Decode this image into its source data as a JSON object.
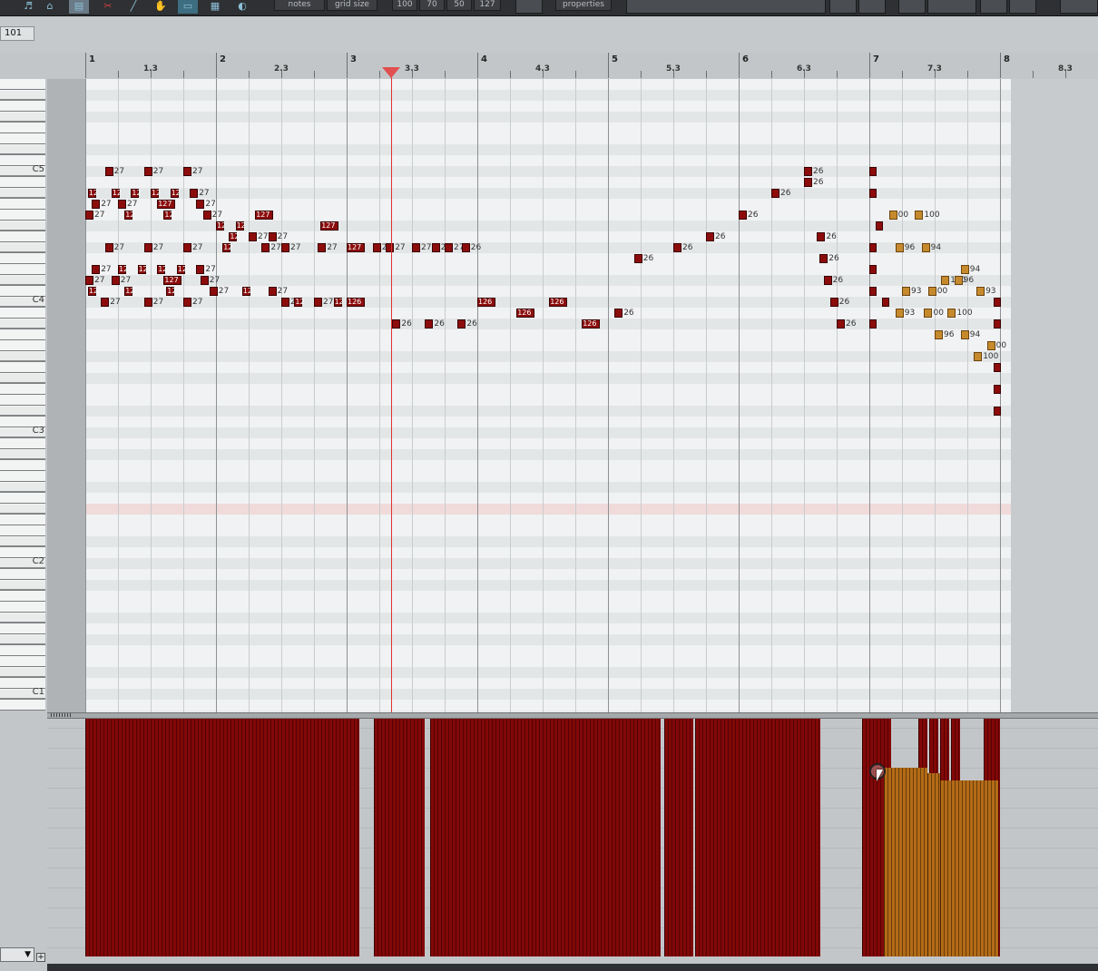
{
  "toolbar": {
    "notes_label": "notes",
    "grid_size_label": "grid size",
    "velocity_presets": [
      "100",
      "70",
      "50",
      "127"
    ],
    "properties_label": "properties"
  },
  "value_box": "101",
  "ruler": {
    "bars": [
      "1",
      "2",
      "3",
      "4",
      "5",
      "6",
      "7",
      "8"
    ],
    "beats": [
      "1.3",
      "2.3",
      "3.3",
      "4.3",
      "5.3",
      "6.3",
      "7.3",
      "8.3"
    ]
  },
  "keyboard": {
    "octave_labels": [
      "C5",
      "C4",
      "C3",
      "C2",
      "C1"
    ]
  },
  "notes": [
    {
      "beat": 0.15,
      "row": 8,
      "v": "27"
    },
    {
      "beat": 0.45,
      "row": 8,
      "v": "27"
    },
    {
      "beat": 0.75,
      "row": 8,
      "v": "27"
    },
    {
      "beat": 0.02,
      "row": 10,
      "v": "12"
    },
    {
      "beat": 0.2,
      "row": 10,
      "v": "12"
    },
    {
      "beat": 0.35,
      "row": 10,
      "v": "12"
    },
    {
      "beat": 0.5,
      "row": 10,
      "v": "12"
    },
    {
      "beat": 0.65,
      "row": 10,
      "v": "12"
    },
    {
      "beat": 0.8,
      "row": 10,
      "v": "27"
    },
    {
      "beat": 0.05,
      "row": 11,
      "v": "27"
    },
    {
      "beat": 0.25,
      "row": 11,
      "v": "27"
    },
    {
      "beat": 0.55,
      "row": 11,
      "v": "127"
    },
    {
      "beat": 0.85,
      "row": 11,
      "v": "27"
    },
    {
      "beat": 0.0,
      "row": 12,
      "v": "27"
    },
    {
      "beat": 0.3,
      "row": 12,
      "v": "12"
    },
    {
      "beat": 0.6,
      "row": 12,
      "v": "12"
    },
    {
      "beat": 0.9,
      "row": 12,
      "v": "27"
    },
    {
      "beat": 1.0,
      "row": 13,
      "v": "12"
    },
    {
      "beat": 1.15,
      "row": 13,
      "v": "12"
    },
    {
      "beat": 1.3,
      "row": 12,
      "v": "127"
    },
    {
      "beat": 1.1,
      "row": 14,
      "v": "12"
    },
    {
      "beat": 1.25,
      "row": 14,
      "v": "27"
    },
    {
      "beat": 1.4,
      "row": 14,
      "v": "27"
    },
    {
      "beat": 1.05,
      "row": 15,
      "v": "12"
    },
    {
      "beat": 1.35,
      "row": 15,
      "v": "27"
    },
    {
      "beat": 1.5,
      "row": 15,
      "v": "27"
    },
    {
      "beat": 0.15,
      "row": 15,
      "v": "27"
    },
    {
      "beat": 0.45,
      "row": 15,
      "v": "27"
    },
    {
      "beat": 0.75,
      "row": 15,
      "v": "27"
    },
    {
      "beat": 1.8,
      "row": 13,
      "v": "127"
    },
    {
      "beat": 1.78,
      "row": 15,
      "v": "27"
    },
    {
      "beat": 2.0,
      "row": 15,
      "v": "127"
    },
    {
      "beat": 2.2,
      "row": 15,
      "v": "27"
    },
    {
      "beat": 2.3,
      "row": 15,
      "v": "27"
    },
    {
      "beat": 2.5,
      "row": 15,
      "v": "27"
    },
    {
      "beat": 2.65,
      "row": 15,
      "v": "27"
    },
    {
      "beat": 2.75,
      "row": 15,
      "v": "27"
    },
    {
      "beat": 2.88,
      "row": 15,
      "v": "26"
    },
    {
      "beat": 0.05,
      "row": 17,
      "v": "27"
    },
    {
      "beat": 0.25,
      "row": 17,
      "v": "12"
    },
    {
      "beat": 0.4,
      "row": 17,
      "v": "12"
    },
    {
      "beat": 0.55,
      "row": 17,
      "v": "12"
    },
    {
      "beat": 0.7,
      "row": 17,
      "v": "12"
    },
    {
      "beat": 0.85,
      "row": 17,
      "v": "27"
    },
    {
      "beat": 0.0,
      "row": 18,
      "v": "27"
    },
    {
      "beat": 0.2,
      "row": 18,
      "v": "27"
    },
    {
      "beat": 0.6,
      "row": 18,
      "v": "127"
    },
    {
      "beat": 0.88,
      "row": 18,
      "v": "27"
    },
    {
      "beat": 0.02,
      "row": 19,
      "v": "12"
    },
    {
      "beat": 0.3,
      "row": 19,
      "v": "12"
    },
    {
      "beat": 0.62,
      "row": 19,
      "v": "12"
    },
    {
      "beat": 0.95,
      "row": 19,
      "v": "27"
    },
    {
      "beat": 1.2,
      "row": 19,
      "v": "12"
    },
    {
      "beat": 1.4,
      "row": 19,
      "v": "27"
    },
    {
      "beat": 1.5,
      "row": 20,
      "v": "27"
    },
    {
      "beat": 1.6,
      "row": 20,
      "v": "12"
    },
    {
      "beat": 1.75,
      "row": 20,
      "v": "27"
    },
    {
      "beat": 1.9,
      "row": 20,
      "v": "12"
    },
    {
      "beat": 0.12,
      "row": 20,
      "v": "27"
    },
    {
      "beat": 0.45,
      "row": 20,
      "v": "27"
    },
    {
      "beat": 0.75,
      "row": 20,
      "v": "27"
    },
    {
      "beat": 2.0,
      "row": 20,
      "v": "126"
    },
    {
      "beat": 2.35,
      "row": 22,
      "v": "26"
    },
    {
      "beat": 2.6,
      "row": 22,
      "v": "26"
    },
    {
      "beat": 2.85,
      "row": 22,
      "v": "26"
    },
    {
      "beat": 3.0,
      "row": 20,
      "v": "126"
    },
    {
      "beat": 3.3,
      "row": 21,
      "v": "126"
    },
    {
      "beat": 3.55,
      "row": 20,
      "v": "126"
    },
    {
      "beat": 3.8,
      "row": 22,
      "v": "126"
    },
    {
      "beat": 4.05,
      "row": 21,
      "v": "26"
    },
    {
      "beat": 4.2,
      "row": 16,
      "v": "26"
    },
    {
      "beat": 4.5,
      "row": 15,
      "v": "26"
    },
    {
      "beat": 4.75,
      "row": 14,
      "v": "26"
    },
    {
      "beat": 5.0,
      "row": 12,
      "v": "26"
    },
    {
      "beat": 5.25,
      "row": 10,
      "v": "26"
    },
    {
      "beat": 5.5,
      "row": 8,
      "v": "26"
    },
    {
      "beat": 5.5,
      "row": 9,
      "v": "26"
    },
    {
      "beat": 5.6,
      "row": 14,
      "v": "26"
    },
    {
      "beat": 5.62,
      "row": 16,
      "v": "26"
    },
    {
      "beat": 5.65,
      "row": 18,
      "v": "26"
    },
    {
      "beat": 5.7,
      "row": 20,
      "v": "26"
    },
    {
      "beat": 5.75,
      "row": 22,
      "v": "26"
    }
  ],
  "orange_velocities": [
    "00",
    "100",
    "96",
    "94",
    "93"
  ],
  "cc_lane": {
    "selected_lane": "▼"
  },
  "colors": {
    "note_red": "#8c0c0c",
    "note_orange": "#c68a2d",
    "playhead": "#dd3333",
    "background": "#c3c6c8"
  }
}
